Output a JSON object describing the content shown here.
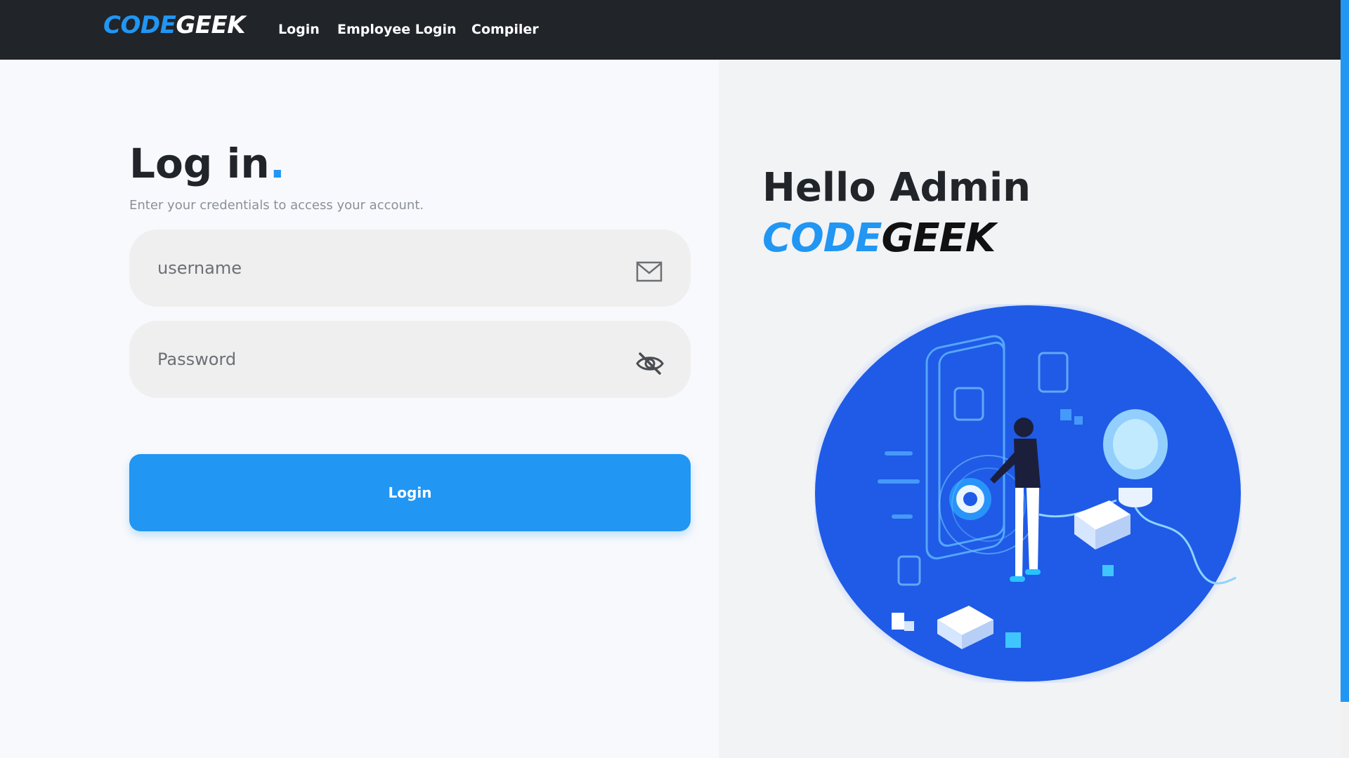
{
  "navbar": {
    "brand_code": "CODE",
    "brand_geek": "GEEK",
    "links": [
      "Login",
      "Employee Login",
      "Compiler"
    ]
  },
  "login_form": {
    "title": "Log in",
    "title_dot": ".",
    "subtitle": "Enter your credentials to access your account.",
    "username_placeholder": "username",
    "password_placeholder": "Password",
    "submit_label": "Login"
  },
  "hero": {
    "greeting": "Hello Admin",
    "brand_code": "CODE",
    "brand_geek": "GEEK"
  },
  "icons": {
    "username": "mail-icon",
    "password": "eye-slash-icon"
  },
  "colors": {
    "accent": "#2196f3",
    "navbar_bg": "#212429",
    "illustration_blue": "#1f5be6"
  }
}
